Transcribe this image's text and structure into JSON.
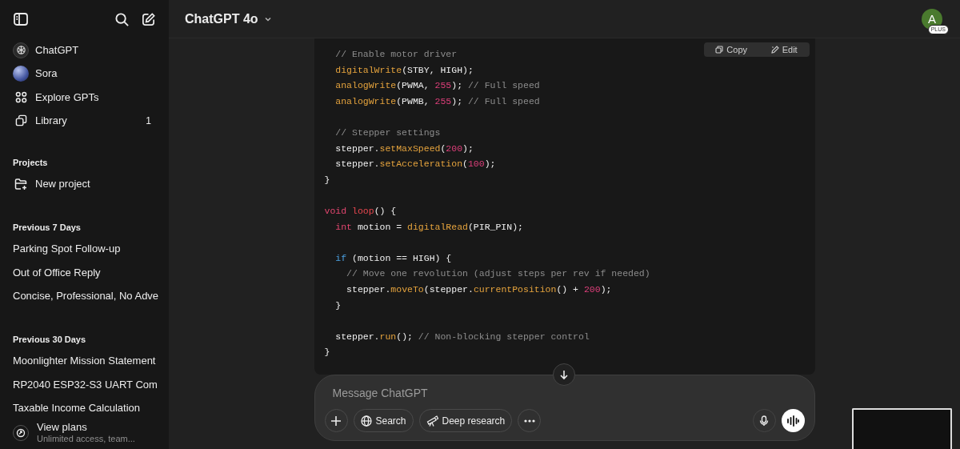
{
  "sidebar": {
    "nav": [
      {
        "kind": "logo",
        "label": "ChatGPT"
      },
      {
        "kind": "sphere",
        "label": "Sora"
      },
      {
        "kind": "grid",
        "label": "Explore GPTs"
      },
      {
        "kind": "library",
        "label": "Library",
        "count": "1"
      }
    ],
    "projects": {
      "heading": "Projects",
      "items": [
        {
          "kind": "folder-plus",
          "label": "New project"
        }
      ]
    },
    "history": [
      {
        "heading": "Previous 7 Days",
        "items": [
          "Parking Spot Follow-up",
          "Out of Office Reply",
          "Concise, Professional, No Adve"
        ]
      },
      {
        "heading": "Previous 30 Days",
        "items": [
          "Moonlighter Mission Statement",
          "RP2040 ESP32-S3 UART Com",
          "Taxable Income Calculation"
        ]
      }
    ],
    "upgrade": {
      "title": "View plans",
      "subtitle": "Unlimited access, team..."
    }
  },
  "header": {
    "model": "ChatGPT 4o",
    "avatar": {
      "initial": "A",
      "badge": "PLUS"
    }
  },
  "code_block": {
    "actions": [
      "Copy",
      "Edit"
    ],
    "lines": [
      {
        "kind": "code",
        "tokens": [
          {
            "kind": "comment",
            "text": "  // Enable motor driver"
          }
        ]
      },
      {
        "kind": "code",
        "tokens": [
          {
            "kind": "function",
            "text": "  digitalWrite"
          },
          {
            "kind": "plain",
            "text": "(STBY, HIGH);"
          }
        ]
      },
      {
        "kind": "code",
        "tokens": [
          {
            "kind": "function",
            "text": "  analogWrite"
          },
          {
            "kind": "plain",
            "text": "(PWMA, "
          },
          {
            "kind": "number",
            "text": "255"
          },
          {
            "kind": "plain",
            "text": "); "
          },
          {
            "kind": "comment",
            "text": "// Full speed"
          }
        ]
      },
      {
        "kind": "code",
        "tokens": [
          {
            "kind": "function",
            "text": "  analogWrite"
          },
          {
            "kind": "plain",
            "text": "(PWMB, "
          },
          {
            "kind": "number",
            "text": "255"
          },
          {
            "kind": "plain",
            "text": "); "
          },
          {
            "kind": "comment",
            "text": "// Full speed"
          }
        ]
      },
      {
        "kind": "blank"
      },
      {
        "kind": "code",
        "tokens": [
          {
            "kind": "comment",
            "text": "  // Stepper settings"
          }
        ]
      },
      {
        "kind": "code",
        "tokens": [
          {
            "kind": "plain",
            "text": "  stepper."
          },
          {
            "kind": "function",
            "text": "setMaxSpeed"
          },
          {
            "kind": "plain",
            "text": "("
          },
          {
            "kind": "number",
            "text": "200"
          },
          {
            "kind": "plain",
            "text": ");"
          }
        ]
      },
      {
        "kind": "code",
        "tokens": [
          {
            "kind": "plain",
            "text": "  stepper."
          },
          {
            "kind": "function",
            "text": "setAcceleration"
          },
          {
            "kind": "plain",
            "text": "("
          },
          {
            "kind": "number",
            "text": "100"
          },
          {
            "kind": "plain",
            "text": ");"
          }
        ]
      },
      {
        "kind": "code",
        "tokens": [
          {
            "kind": "plain",
            "text": "}"
          }
        ]
      },
      {
        "kind": "blank"
      },
      {
        "kind": "code",
        "tokens": [
          {
            "kind": "keyword",
            "text": "void"
          },
          {
            "kind": "definition",
            "text": " loop"
          },
          {
            "kind": "plain",
            "text": "() {"
          }
        ]
      },
      {
        "kind": "code",
        "tokens": [
          {
            "kind": "keyword",
            "text": "  int"
          },
          {
            "kind": "plain",
            "text": " motion = "
          },
          {
            "kind": "function",
            "text": "digitalRead"
          },
          {
            "kind": "plain",
            "text": "(PIR_PIN);"
          }
        ]
      },
      {
        "kind": "blank"
      },
      {
        "kind": "code",
        "tokens": [
          {
            "kind": "control",
            "text": "  if"
          },
          {
            "kind": "plain",
            "text": " (motion == HIGH) {"
          }
        ]
      },
      {
        "kind": "code",
        "tokens": [
          {
            "kind": "comment",
            "text": "    // Move one revolution (adjust steps per rev if needed)"
          }
        ]
      },
      {
        "kind": "code",
        "tokens": [
          {
            "kind": "plain",
            "text": "    stepper."
          },
          {
            "kind": "function",
            "text": "moveTo"
          },
          {
            "kind": "plain",
            "text": "(stepper."
          },
          {
            "kind": "function",
            "text": "currentPosition"
          },
          {
            "kind": "plain",
            "text": "() + "
          },
          {
            "kind": "number",
            "text": "200"
          },
          {
            "kind": "plain",
            "text": ");"
          }
        ]
      },
      {
        "kind": "code",
        "tokens": [
          {
            "kind": "plain",
            "text": "  }"
          }
        ]
      },
      {
        "kind": "blank"
      },
      {
        "kind": "code",
        "tokens": [
          {
            "kind": "plain",
            "text": "  stepper."
          },
          {
            "kind": "function",
            "text": "run"
          },
          {
            "kind": "plain",
            "text": "(); "
          },
          {
            "kind": "comment",
            "text": "// Non-blocking stepper control"
          }
        ]
      },
      {
        "kind": "code",
        "tokens": [
          {
            "kind": "plain",
            "text": "}"
          }
        ]
      }
    ]
  },
  "composer": {
    "placeholder": "Message ChatGPT",
    "tools": [
      {
        "kind": "plus"
      },
      {
        "kind": "globe",
        "label": "Search"
      },
      {
        "kind": "telescope",
        "label": "Deep research"
      },
      {
        "kind": "more"
      }
    ]
  }
}
